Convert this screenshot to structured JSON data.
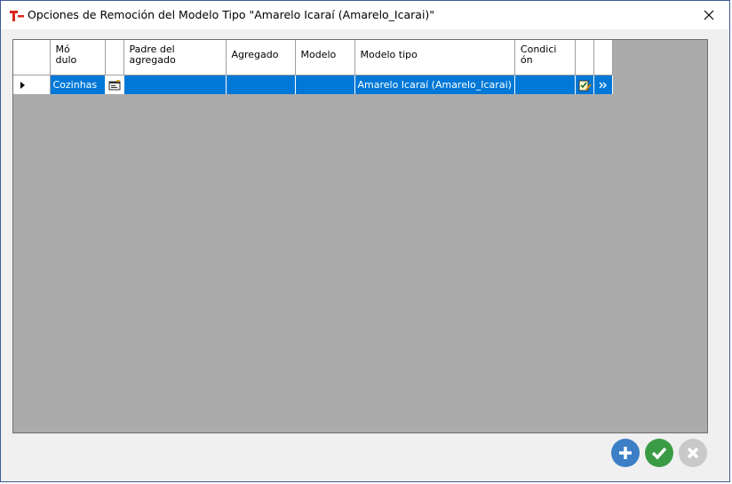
{
  "window": {
    "title": "Opciones de Remoción del Modelo Tipo \"Amarelo Icaraí (Amarelo_Icarai)\"",
    "app_icon": "t-app-icon",
    "close_icon": "close-icon"
  },
  "grid": {
    "columns": [
      "Mó\ndulo",
      "",
      "Padre del\nagregado",
      "Agregado",
      "Modelo",
      "Modelo tipo",
      "Condici\nón",
      "",
      ""
    ],
    "rows": [
      {
        "selected": true,
        "modulo": "Cozinhas",
        "padre": "",
        "agregado": "",
        "modelo": "",
        "modelo_tipo": "Amarelo Icaraí (Amarelo_Icarai)",
        "condicion": ""
      }
    ]
  },
  "buttons": {
    "add_icon": "plus-icon",
    "ok_icon": "check-icon",
    "cancel_icon": "x-icon"
  },
  "colors": {
    "selection": "#0078d7",
    "add": "#3d7fc7",
    "ok": "#3a9b45",
    "cancel": "#c9c9c9",
    "grid_background": "#ababab"
  }
}
